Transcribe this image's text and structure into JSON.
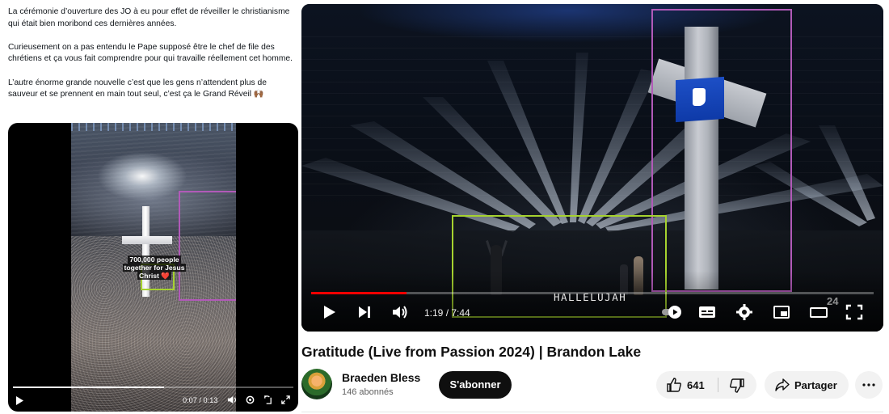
{
  "tweet": {
    "paragraphs": [
      "La cérémonie d’ouverture des JO à eu pour effet de réveiller le christianisme qui était bien moribond ces dernières années.",
      "Curieusement on a pas entendu le Pape supposé être le chef de file des chrétiens et ça vous fait comprendre pour qui travaille réellement cet homme.",
      "L’autre énorme grande nouvelle c’est que les gens n’attendent plus de sauveur et se prennent en main tout seul, c’est ça le Grand Réveil 🙌🏾"
    ],
    "video": {
      "caption_line1": "700,000 people",
      "caption_line2": "together for Jesus",
      "caption_line3": "Christ ❤️",
      "time": "0:07 / 0:13",
      "progress": 0.54,
      "highlight_colors": {
        "purple": "#b15ab8",
        "green": "#a6d22f"
      }
    }
  },
  "youtube": {
    "player": {
      "lyric": "HALLELUJAH",
      "watermark": "24",
      "time": "1:19 / 7:44",
      "progress": 0.17,
      "progress_color": "#ff0000",
      "icons": [
        "play-icon",
        "next-icon",
        "volume-icon",
        "autoplay-toggle",
        "subtitles-icon",
        "settings-icon",
        "miniplayer-icon",
        "theater-icon",
        "fullscreen-icon"
      ]
    },
    "title": "Gratitude (Live from Passion 2024) | Brandon Lake",
    "channel": {
      "name": "Braeden Bless",
      "subscribers": "146 abonnés"
    },
    "subscribe_label": "S'abonner",
    "like_count": "641",
    "share_label": "Partager"
  }
}
